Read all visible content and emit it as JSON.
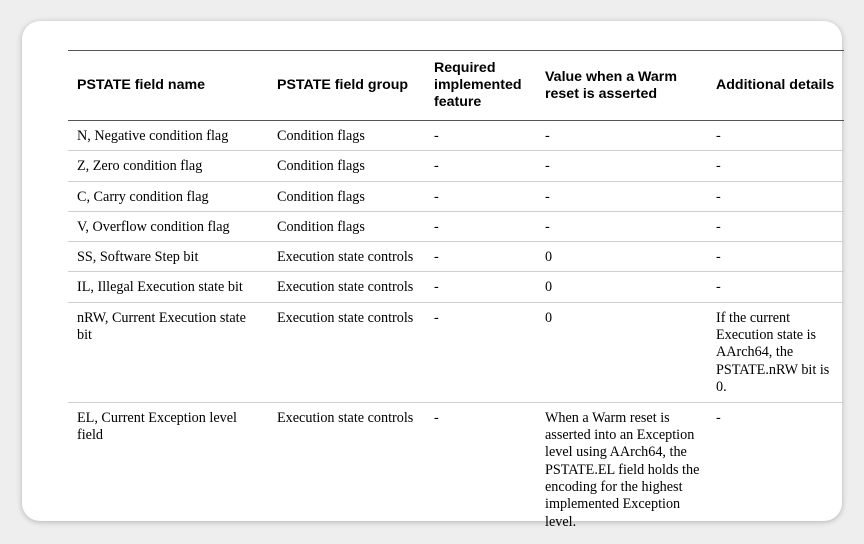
{
  "table": {
    "headers": [
      "PSTATE field name",
      "PSTATE field group",
      "Required implemented feature",
      "Value when a Warm reset is asserted",
      "Additional details"
    ],
    "rows": [
      {
        "name": "N, Negative condition flag",
        "group": "Condition flags",
        "feature": "-",
        "value": "-",
        "details": "-"
      },
      {
        "name": "Z, Zero condition flag",
        "group": "Condition flags",
        "feature": "-",
        "value": "-",
        "details": "-"
      },
      {
        "name": "C, Carry condition flag",
        "group": "Condition flags",
        "feature": "-",
        "value": "-",
        "details": "-"
      },
      {
        "name": "V, Overflow condition flag",
        "group": "Condition flags",
        "feature": "-",
        "value": "-",
        "details": "-"
      },
      {
        "name": "SS, Software Step bit",
        "group": "Execution state controls",
        "feature": "-",
        "value": "0",
        "details": "-"
      },
      {
        "name": "IL, Illegal Execution state bit",
        "group": "Execution state controls",
        "feature": "-",
        "value": "0",
        "details": "-"
      },
      {
        "name": "nRW, Current Execution state bit",
        "group": "Execution state controls",
        "feature": "-",
        "value": "0",
        "details": "If the current Execution state is AArch64, the PSTATE.nRW bit is 0."
      },
      {
        "name": "EL, Current Exception level field",
        "group": "Execution state controls",
        "feature": "-",
        "value_prefix": "When a Warm reset is asserted into an Exception level using AArch64, the PSTATE.EL field holds the encoding for the ",
        "value_underlined_1": "highest implemented",
        "value_underlined_2": "Exception level.",
        "details": "-"
      }
    ]
  },
  "highlight_color": "#e0101a"
}
